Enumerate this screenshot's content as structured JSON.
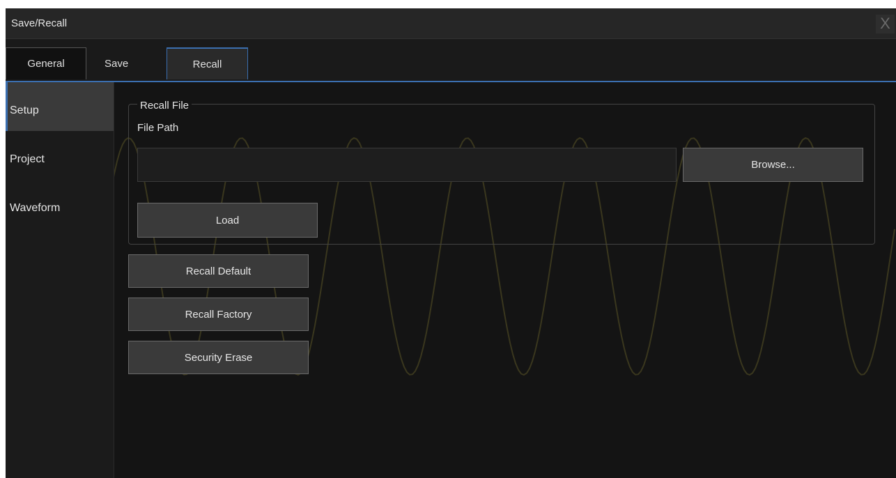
{
  "window": {
    "title": "Save/Recall",
    "close_label": "X"
  },
  "tabs": [
    {
      "label": "General"
    },
    {
      "label": "Save"
    },
    {
      "label": "Recall",
      "active": true
    }
  ],
  "sidebar": {
    "items": [
      {
        "label": "Setup",
        "active": true
      },
      {
        "label": "Project"
      },
      {
        "label": "Waveform"
      }
    ]
  },
  "recall_file": {
    "group_label": "Recall File",
    "file_path_label": "File Path",
    "file_path_value": "",
    "browse_label": "Browse...",
    "load_label": "Load"
  },
  "actions": {
    "recall_default_label": "Recall Default",
    "recall_factory_label": "Recall Factory",
    "security_erase_label": "Security Erase"
  },
  "colors": {
    "accent": "#3b6fb0",
    "background": "#141414",
    "button": "#3a3a3a",
    "waveform": "#5a5426"
  }
}
